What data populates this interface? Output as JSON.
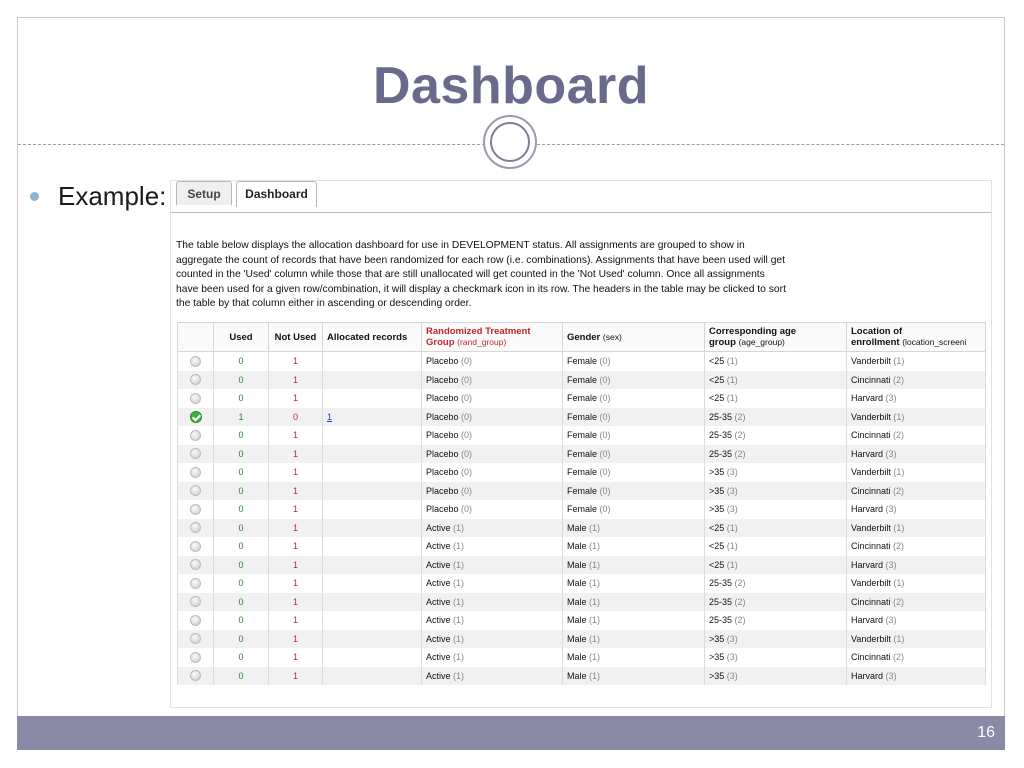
{
  "slide": {
    "title": "Dashboard",
    "bullet": "Example:",
    "page_number": "16"
  },
  "tabs": [
    "Setup",
    "Dashboard"
  ],
  "description": "The table below displays the allocation dashboard for use in DEVELOPMENT status. All assignments are grouped to show in aggregate the count of records that have been randomized for each row (i.e. combinations). Assignments that have been used will get counted in the 'Used' column while those that are still unallocated will get counted in the 'Not Used' column. Once all assignments have been used for a given row/combination, it will display a checkmark icon in its row. The headers in the table may be clicked to sort the table by that column either in ascending or descending order.",
  "columns": {
    "used": "Used",
    "not_used": "Not Used",
    "allocated": "Allocated records",
    "rand_main": "Randomized Treatment",
    "rand_second": "Group",
    "rand_var": "(rand_group)",
    "gender_main": "Gender",
    "gender_var": "(sex)",
    "age_main": "Corresponding age",
    "age_second": "group",
    "age_var": "(age_group)",
    "loc_main": "Location of",
    "loc_second": "enrollment",
    "loc_var": "(location_screeni"
  },
  "rows": [
    {
      "status": "empty",
      "used": "0",
      "not_used": "1",
      "allocated": "",
      "group": "Placebo",
      "group_code": "(0)",
      "sex": "Female",
      "sex_code": "(0)",
      "age": "<25",
      "age_code": "(1)",
      "loc": "Vanderbilt",
      "loc_code": "(1)"
    },
    {
      "status": "empty",
      "used": "0",
      "not_used": "1",
      "allocated": "",
      "group": "Placebo",
      "group_code": "(0)",
      "sex": "Female",
      "sex_code": "(0)",
      "age": "<25",
      "age_code": "(1)",
      "loc": "Cincinnati",
      "loc_code": "(2)"
    },
    {
      "status": "empty",
      "used": "0",
      "not_used": "1",
      "allocated": "",
      "group": "Placebo",
      "group_code": "(0)",
      "sex": "Female",
      "sex_code": "(0)",
      "age": "<25",
      "age_code": "(1)",
      "loc": "Harvard",
      "loc_code": "(3)"
    },
    {
      "status": "check",
      "used": "1",
      "not_used": "0",
      "allocated": "1",
      "group": "Placebo",
      "group_code": "(0)",
      "sex": "Female",
      "sex_code": "(0)",
      "age": "25-35",
      "age_code": "(2)",
      "loc": "Vanderbilt",
      "loc_code": "(1)"
    },
    {
      "status": "empty",
      "used": "0",
      "not_used": "1",
      "allocated": "",
      "group": "Placebo",
      "group_code": "(0)",
      "sex": "Female",
      "sex_code": "(0)",
      "age": "25-35",
      "age_code": "(2)",
      "loc": "Cincinnati",
      "loc_code": "(2)"
    },
    {
      "status": "empty",
      "used": "0",
      "not_used": "1",
      "allocated": "",
      "group": "Placebo",
      "group_code": "(0)",
      "sex": "Female",
      "sex_code": "(0)",
      "age": "25-35",
      "age_code": "(2)",
      "loc": "Harvard",
      "loc_code": "(3)"
    },
    {
      "status": "empty",
      "used": "0",
      "not_used": "1",
      "allocated": "",
      "group": "Placebo",
      "group_code": "(0)",
      "sex": "Female",
      "sex_code": "(0)",
      "age": ">35",
      "age_code": "(3)",
      "loc": "Vanderbilt",
      "loc_code": "(1)"
    },
    {
      "status": "empty",
      "used": "0",
      "not_used": "1",
      "allocated": "",
      "group": "Placebo",
      "group_code": "(0)",
      "sex": "Female",
      "sex_code": "(0)",
      "age": ">35",
      "age_code": "(3)",
      "loc": "Cincinnati",
      "loc_code": "(2)"
    },
    {
      "status": "empty",
      "used": "0",
      "not_used": "1",
      "allocated": "",
      "group": "Placebo",
      "group_code": "(0)",
      "sex": "Female",
      "sex_code": "(0)",
      "age": ">35",
      "age_code": "(3)",
      "loc": "Harvard",
      "loc_code": "(3)"
    },
    {
      "status": "empty",
      "used": "0",
      "not_used": "1",
      "allocated": "",
      "group": "Active",
      "group_code": "(1)",
      "sex": "Male",
      "sex_code": "(1)",
      "age": "<25",
      "age_code": "(1)",
      "loc": "Vanderbilt",
      "loc_code": "(1)"
    },
    {
      "status": "empty",
      "used": "0",
      "not_used": "1",
      "allocated": "",
      "group": "Active",
      "group_code": "(1)",
      "sex": "Male",
      "sex_code": "(1)",
      "age": "<25",
      "age_code": "(1)",
      "loc": "Cincinnati",
      "loc_code": "(2)"
    },
    {
      "status": "empty",
      "used": "0",
      "not_used": "1",
      "allocated": "",
      "group": "Active",
      "group_code": "(1)",
      "sex": "Male",
      "sex_code": "(1)",
      "age": "<25",
      "age_code": "(1)",
      "loc": "Harvard",
      "loc_code": "(3)"
    },
    {
      "status": "empty",
      "used": "0",
      "not_used": "1",
      "allocated": "",
      "group": "Active",
      "group_code": "(1)",
      "sex": "Male",
      "sex_code": "(1)",
      "age": "25-35",
      "age_code": "(2)",
      "loc": "Vanderbilt",
      "loc_code": "(1)"
    },
    {
      "status": "empty",
      "used": "0",
      "not_used": "1",
      "allocated": "",
      "group": "Active",
      "group_code": "(1)",
      "sex": "Male",
      "sex_code": "(1)",
      "age": "25-35",
      "age_code": "(2)",
      "loc": "Cincinnati",
      "loc_code": "(2)"
    },
    {
      "status": "empty",
      "used": "0",
      "not_used": "1",
      "allocated": "",
      "group": "Active",
      "group_code": "(1)",
      "sex": "Male",
      "sex_code": "(1)",
      "age": "25-35",
      "age_code": "(2)",
      "loc": "Harvard",
      "loc_code": "(3)"
    },
    {
      "status": "empty",
      "used": "0",
      "not_used": "1",
      "allocated": "",
      "group": "Active",
      "group_code": "(1)",
      "sex": "Male",
      "sex_code": "(1)",
      "age": ">35",
      "age_code": "(3)",
      "loc": "Vanderbilt",
      "loc_code": "(1)"
    },
    {
      "status": "empty",
      "used": "0",
      "not_used": "1",
      "allocated": "",
      "group": "Active",
      "group_code": "(1)",
      "sex": "Male",
      "sex_code": "(1)",
      "age": ">35",
      "age_code": "(3)",
      "loc": "Cincinnati",
      "loc_code": "(2)"
    },
    {
      "status": "empty",
      "used": "0",
      "not_used": "1",
      "allocated": "",
      "group": "Active",
      "group_code": "(1)",
      "sex": "Male",
      "sex_code": "(1)",
      "age": ">35",
      "age_code": "(3)",
      "loc": "Harvard",
      "loc_code": "(3)"
    }
  ],
  "icons": {
    "status_empty": "status-empty-icon",
    "status_check": "checkmark-icon",
    "bullet": "bullet-icon"
  },
  "colors": {
    "title": "#6a6b8c",
    "footer": "#8a89a6",
    "used": "#1f8a1f",
    "not_used": "#c0282a",
    "link": "#1a3ccf",
    "check": "#3fae3f"
  }
}
